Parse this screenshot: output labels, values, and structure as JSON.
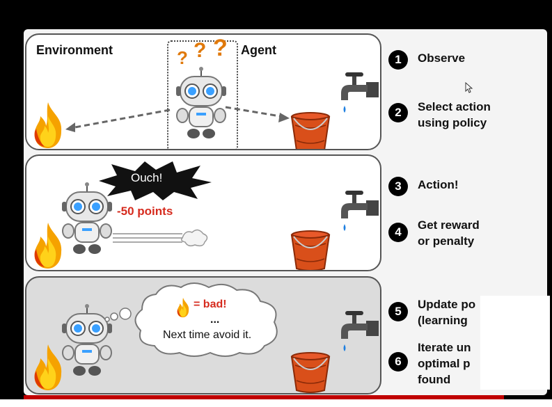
{
  "panel1": {
    "environment_label": "Environment",
    "agent_label": "Agent",
    "question_marks": "?",
    "robot_icon": "robot-icon",
    "fire_icon": "fire-icon",
    "bucket_icon": "bucket-icon",
    "faucet_icon": "faucet-icon"
  },
  "panel2": {
    "ouch_text": "Ouch!",
    "points_text": "-50 points",
    "points_color": "#d62b1e"
  },
  "panel3": {
    "bad_text": "= bad!",
    "ellipsis": "...",
    "thought_text": "Next time avoid it."
  },
  "steps": [
    {
      "num": "1",
      "text": "Observe"
    },
    {
      "num": "2",
      "text": "Select action\nusing policy"
    },
    {
      "num": "3",
      "text": "Action!"
    },
    {
      "num": "4",
      "text": "Get reward\nor penalty"
    },
    {
      "num": "5",
      "text": "Update po\n(learning"
    },
    {
      "num": "6",
      "text": "Iterate un\noptimal p\nfound"
    }
  ],
  "colors": {
    "fire": "#f5a200",
    "bucket": "#d94f1a",
    "robot_eye": "#3aa0ff",
    "accent_red": "#c00000"
  }
}
